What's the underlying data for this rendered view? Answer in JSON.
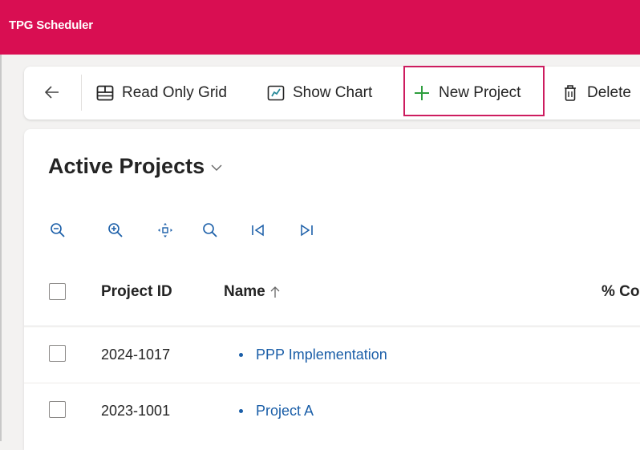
{
  "app": {
    "title": "TPG Scheduler",
    "brand_color": "#d90e52"
  },
  "command_bar": {
    "back_icon": "arrow-left-icon",
    "buttons": [
      {
        "label": "Read Only Grid",
        "icon": "grid-icon"
      },
      {
        "label": "Show Chart",
        "icon": "chart-icon"
      },
      {
        "label": "New Project",
        "icon": "plus-icon",
        "highlighted": true
      },
      {
        "label": "Delete",
        "icon": "trash-icon"
      }
    ]
  },
  "view": {
    "title": "Active Projects",
    "selector_icon": "chevron-down-icon"
  },
  "gantt_toolbar": {
    "tools": [
      "zoom-out-icon",
      "zoom-in-icon",
      "fit-to-screen-icon",
      "search-icon",
      "go-to-start-icon",
      "go-to-end-icon"
    ]
  },
  "grid": {
    "columns": [
      {
        "label": "Project ID"
      },
      {
        "label": "Name",
        "sort": "ascending"
      },
      {
        "label": "% Co"
      }
    ],
    "rows": [
      {
        "project_id": "2024-1017",
        "name": "PPP Implementation"
      },
      {
        "project_id": "2023-1001",
        "name": "Project A"
      }
    ]
  },
  "colors": {
    "accent_blue": "#1a5ea8",
    "highlight_border": "#cd1c5f"
  }
}
